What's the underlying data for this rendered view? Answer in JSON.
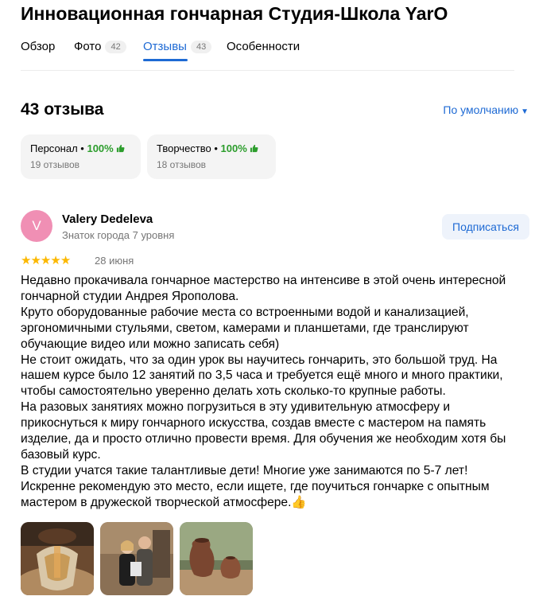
{
  "header": {
    "title": "Инновационная гончарная Студия-Школа YarO"
  },
  "tabs": [
    {
      "label": "Обзор",
      "count": ""
    },
    {
      "label": "Фото",
      "count": "42"
    },
    {
      "label": "Отзывы",
      "count": "43"
    },
    {
      "label": "Особенности",
      "count": ""
    }
  ],
  "reviews": {
    "count_label": "43 отзыва",
    "sort_label": "По умолчанию",
    "aspects": [
      {
        "name": "Персонал",
        "percent": "100%",
        "reviews": "19 отзывов"
      },
      {
        "name": "Творчество",
        "percent": "100%",
        "reviews": "18 отзывов"
      }
    ]
  },
  "review": {
    "avatar_letter": "V",
    "author": "Valery Dedeleva",
    "level": "Знаток города 7 уровня",
    "subscribe_label": "Подписаться",
    "rating": 5,
    "date": "28 июня",
    "lines": [
      "Недавно прокачивала гончарное мастерство на интенсиве в этой очень интересной",
      "гончарной студии Андрея Ярополова.",
      "Круто оборудованные рабочие места со встроенными водой и канализацией,",
      "эргономичными стульями, светом, камерами и планшетами, где транслируют",
      "обучающие видео или можно записать себя)",
      "Не стоит ожидать, что за один урок вы научитесь гончарить, это большой труд. На",
      "нашем курсе было 12 занятий по 3,5 часа и требуется ещё много и много практики,",
      "чтобы самостоятельно уверенно делать хоть сколько-то крупные работы.",
      "На разовых занятиях можно погрузиться в эту удивительную атмосферу и",
      "прикоснуться к миру гончарного искусства, создав вместе с мастером на память",
      "изделие, да и просто отлично провести время. Для обучения же необходим хотя бы",
      "базовый курс.",
      "В студии учатся такие талантливые дети! Многие уже занимаются по 5-7 лет!",
      "Искренне рекомендую это место, если ищете, где поучиться гончарке с опытным",
      "мастером в дружеской творческой атмосфере.👍"
    ]
  },
  "colors": {
    "accent": "#1e6ad4",
    "positive": "#2c9d2c",
    "star": "#fcb800",
    "avatar_bg": "#f08fb4"
  }
}
